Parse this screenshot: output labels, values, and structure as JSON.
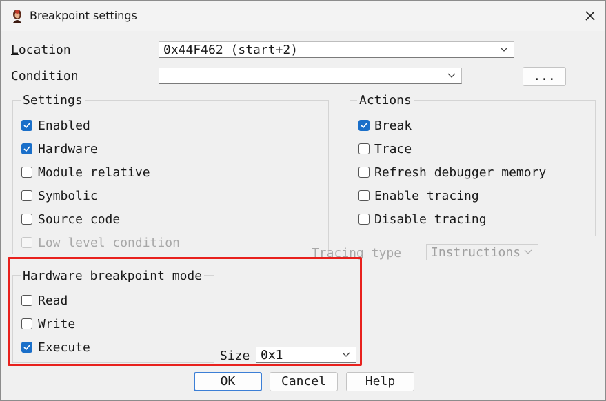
{
  "window": {
    "title": "Breakpoint settings"
  },
  "location": {
    "label": "Location",
    "value": "0x44F462 (start+2)"
  },
  "condition": {
    "label": "Condition",
    "value": "",
    "browse_label": "..."
  },
  "settings": {
    "title": "Settings",
    "items": [
      {
        "label": "Enabled",
        "checked": true,
        "disabled": false
      },
      {
        "label": "Hardware",
        "checked": true,
        "disabled": false
      },
      {
        "label": "Module relative",
        "checked": false,
        "disabled": false
      },
      {
        "label": "Symbolic",
        "checked": false,
        "disabled": false
      },
      {
        "label": "Source code",
        "checked": false,
        "disabled": false
      },
      {
        "label": "Low level condition",
        "checked": false,
        "disabled": true
      }
    ]
  },
  "actions": {
    "title": "Actions",
    "items": [
      {
        "label": "Break",
        "checked": true
      },
      {
        "label": "Trace",
        "checked": false
      },
      {
        "label": "Refresh debugger memory",
        "checked": false
      },
      {
        "label": "Enable tracing",
        "checked": false
      },
      {
        "label": "Disable tracing",
        "checked": false
      }
    ]
  },
  "tracing_type": {
    "label": "Tracing type",
    "value": "Instructions"
  },
  "hw_mode": {
    "title": "Hardware breakpoint mode",
    "items": [
      {
        "label": "Read",
        "checked": false
      },
      {
        "label": "Write",
        "checked": false
      },
      {
        "label": "Execute",
        "checked": true
      }
    ]
  },
  "size": {
    "label": "Size",
    "value": "0x1"
  },
  "buttons": {
    "ok": "OK",
    "cancel": "Cancel",
    "help": "Help"
  },
  "colors": {
    "accent": "#1a6fc9",
    "highlight": "#e8211d",
    "default_border": "#3c7fd6"
  }
}
